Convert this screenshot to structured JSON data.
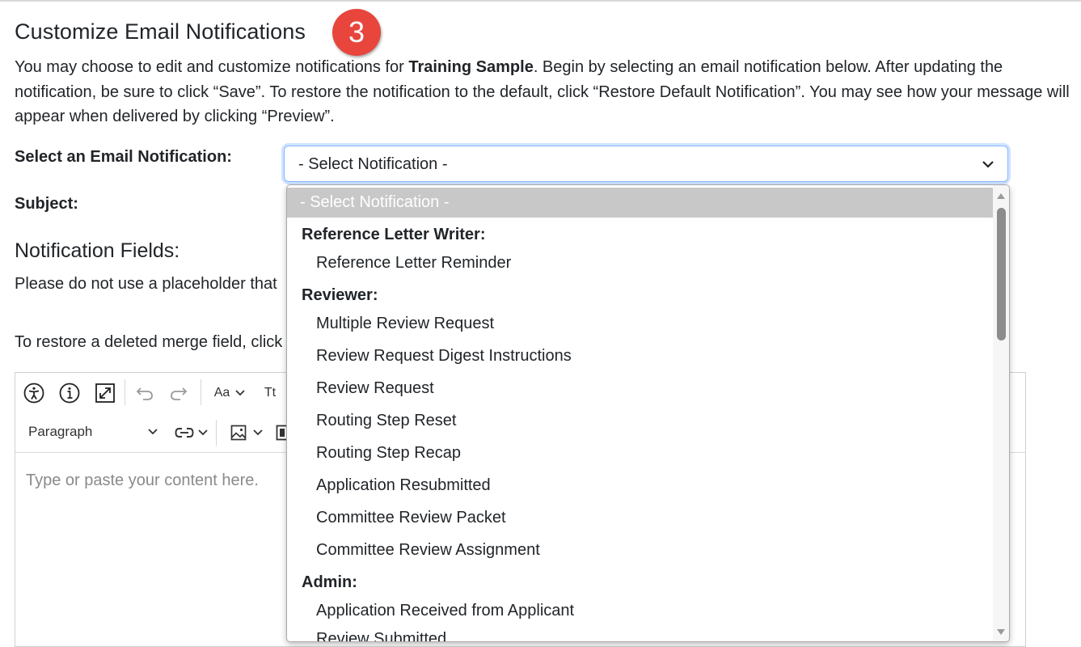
{
  "page": {
    "heading": "Customize Email Notifications",
    "step_badge": "3",
    "intro_part1": "You may choose to edit and customize notifications for ",
    "intro_bold": "Training Sample",
    "intro_part2": ". Begin by selecting an email notification below. After updating the notification, be sure to click “Save”. To restore the notification to the default, click “Restore Default Notification”. You may see how your message will appear when delivered by clicking “Preview”."
  },
  "form": {
    "select_label": "Select an Email Notification:",
    "select_value": "- Select Notification -",
    "subject_label": "Subject:"
  },
  "fields": {
    "title": "Notification Fields:",
    "placeholder_note": "Please do not use a placeholder that",
    "restore_note": "To restore a deleted merge field, click"
  },
  "editor": {
    "paragraph_label": "Paragraph",
    "font_size_label": "Aa",
    "text_case_label": "Tt",
    "placeholder": "Type or paste your content here."
  },
  "dropdown": {
    "selected": "- Select Notification -",
    "groups": [
      {
        "label": "Reference Letter Writer:",
        "options": [
          "Reference Letter Reminder"
        ]
      },
      {
        "label": "Reviewer:",
        "options": [
          "Multiple Review Request",
          "Review Request Digest Instructions",
          "Review Request",
          "Routing Step Reset",
          "Routing Step Recap",
          "Application Resubmitted",
          "Committee Review Packet",
          "Committee Review Assignment"
        ]
      },
      {
        "label": "Admin:",
        "options": [
          "Application Received from Applicant",
          "Review Submitted"
        ]
      }
    ]
  },
  "icons": {
    "accessibility": "accessibility-icon",
    "info": "info-icon",
    "fullscreen": "fullscreen-icon",
    "undo": "undo-icon",
    "redo": "redo-icon",
    "link": "link-icon",
    "image": "image-icon",
    "chevron": "chevron-down-icon"
  },
  "colors": {
    "badge": "#e8453c",
    "focus_border": "#86b7fe",
    "selected_option_bg": "#c8c8c8"
  }
}
